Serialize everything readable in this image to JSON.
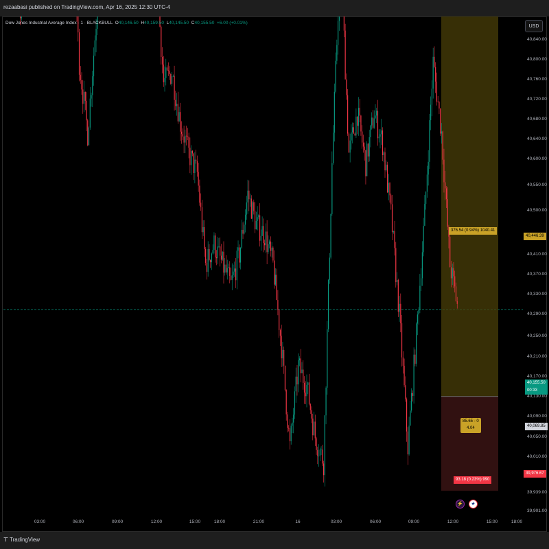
{
  "header": {
    "publisher_line": "rezaabasi published on TradingView.com, Apr 16, 2025 12:30 UTC-4"
  },
  "legend": {
    "title": "Dow Jones Industrial Average Index · 1 · BLACKBULL",
    "o_label": "O",
    "o_value": "40,146.50",
    "h_label": "H",
    "h_value": "40,159.50",
    "l_label": "L",
    "l_value": "40,145.50",
    "c_label": "C",
    "c_value": "40,155.50",
    "change": "+6.00 (+0.01%)"
  },
  "currency_button": "USD",
  "footer": {
    "brand": "TradingView"
  },
  "colors": {
    "up": "#089981",
    "down": "#f23645",
    "target_zone": "#4a3f08",
    "stop_zone": "#3a1414",
    "target_tag": "#c9a227",
    "stop_tag": "#f23645",
    "price_tag": "#089981"
  },
  "position_tool": {
    "target_label": "376.54 (0.94%) 1040.41",
    "entry_label_line1": "85.65 - 0",
    "entry_label_line2": "4.04",
    "stop_label": "93.18 (0.23%) 990",
    "target_price": "40,446.39",
    "entry_price": "40,069.85",
    "stop_price": "39,976.67"
  },
  "current_price": {
    "value": "40,155.50",
    "countdown": "00:33"
  },
  "icons": {
    "event1": "lightning-icon",
    "event2": "us-flag-icon"
  },
  "chart_data": {
    "type": "candlestick",
    "title": "Dow Jones Industrial Average Index · 1 · BLACKBULL",
    "y_ticks": [
      "40,840.00",
      "40,800.00",
      "40,760.00",
      "40,720.00",
      "40,680.00",
      "40,640.00",
      "40,600.00",
      "40,550.00",
      "40,500.00",
      "40,410.00",
      "40,370.00",
      "40,330.00",
      "40,290.00",
      "40,250.00",
      "40,210.00",
      "40,170.00",
      "40,130.00",
      "40,090.00",
      "40,050.00",
      "40,010.00",
      "39,939.00",
      "39,901.00"
    ],
    "x_ticks": [
      "03:00",
      "06:00",
      "09:00",
      "12:00",
      "15:00",
      "18:00",
      "21:00",
      "16",
      "03:00",
      "06:00",
      "09:00",
      "12:00",
      "15:00",
      "18:00"
    ],
    "ylim": [
      39890,
      40860
    ],
    "price_path": [
      {
        "t": "00:00",
        "p": 40520
      },
      {
        "t": "01:00",
        "p": 40480
      },
      {
        "t": "01:40",
        "p": 40455
      },
      {
        "t": "02:30",
        "p": 40525
      },
      {
        "t": "03:20",
        "p": 40670
      },
      {
        "t": "04:20",
        "p": 40590
      },
      {
        "t": "05:10",
        "p": 40530
      },
      {
        "t": "06:00",
        "p": 40570
      },
      {
        "t": "07:10",
        "p": 40560
      },
      {
        "t": "07:50",
        "p": 40400
      },
      {
        "t": "08:30",
        "p": 40330
      },
      {
        "t": "09:20",
        "p": 40440
      },
      {
        "t": "10:00",
        "p": 40600
      },
      {
        "t": "10:40",
        "p": 40790
      },
      {
        "t": "11:00",
        "p": 40620
      },
      {
        "t": "11:40",
        "p": 40680
      },
      {
        "t": "12:20",
        "p": 40650
      },
      {
        "t": "13:00",
        "p": 40660
      },
      {
        "t": "13:50",
        "p": 40510
      },
      {
        "t": "14:40",
        "p": 40380
      },
      {
        "t": "15:30",
        "p": 40390
      },
      {
        "t": "16:20",
        "p": 40340
      },
      {
        "t": "17:00",
        "p": 40310
      },
      {
        "t": "17:30",
        "p": 40290
      },
      {
        "t": "18:00",
        "p": 40200
      },
      {
        "t": "19:00",
        "p": 40220
      },
      {
        "t": "20:00",
        "p": 40200
      },
      {
        "t": "21:00",
        "p": 40180
      },
      {
        "t": "21:40",
        "p": 40210
      },
      {
        "t": "22:20",
        "p": 40270
      },
      {
        "t": "23:20",
        "p": 40240
      },
      {
        "t": "00:20",
        "p": 40230
      },
      {
        "t": "01:00",
        "p": 40200
      },
      {
        "t": "01:40",
        "p": 40120
      },
      {
        "t": "02:10",
        "p": 40020
      },
      {
        "t": "02:50",
        "p": 40100
      },
      {
        "t": "03:40",
        "p": 40080
      },
      {
        "t": "04:20",
        "p": 40030
      },
      {
        "t": "04:40",
        "p": 40005
      },
      {
        "t": "05:00",
        "p": 40300
      },
      {
        "t": "05:30",
        "p": 40510
      },
      {
        "t": "06:00",
        "p": 40310
      },
      {
        "t": "06:40",
        "p": 40350
      },
      {
        "t": "07:20",
        "p": 40300
      },
      {
        "t": "08:00",
        "p": 40350
      },
      {
        "t": "08:40",
        "p": 40320
      },
      {
        "t": "09:20",
        "p": 40250
      },
      {
        "t": "09:50",
        "p": 40150
      },
      {
        "t": "10:20",
        "p": 40020
      },
      {
        "t": "10:50",
        "p": 40130
      },
      {
        "t": "11:20",
        "p": 40250
      },
      {
        "t": "11:40",
        "p": 40400
      },
      {
        "t": "12:00",
        "p": 40330
      },
      {
        "t": "12:20",
        "p": 40200
      },
      {
        "t": "12:40",
        "p": 40155
      }
    ],
    "grid": false
  }
}
